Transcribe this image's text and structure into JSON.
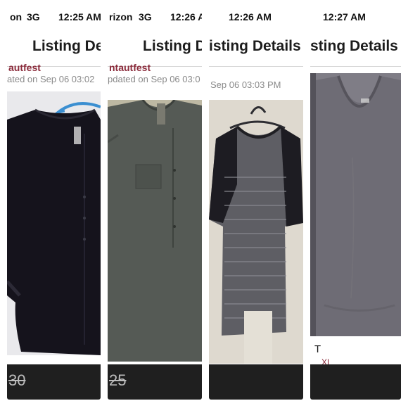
{
  "panels": [
    {
      "status": {
        "carrier": "on",
        "network": "3G",
        "time": "12:25 AM"
      },
      "nav_title": "Listing De",
      "seller": "autfest",
      "updated": "ated on Sep 06 03:02",
      "price": "30",
      "item_title": ""
    },
    {
      "status": {
        "carrier": "rizon",
        "network": "3G",
        "time": "12:26 A"
      },
      "nav_title": "Listing D",
      "seller": "ntautfest",
      "updated": "pdated on Sep 06 03:0",
      "price": "25"
    },
    {
      "status": {
        "time": "12:26 AM"
      },
      "nav_title": "isting Details",
      "updated": "Sep 06 03:03 PM"
    },
    {
      "status": {
        "time": "12:27 AM"
      },
      "nav_title": "sting Details",
      "item_title": "T",
      "size_label": "XL"
    }
  ],
  "colors": {
    "seller_red": "#8a2a3a",
    "bottom_bar": "#1f1f1f",
    "hanger_blue": "#3b8fd1"
  }
}
